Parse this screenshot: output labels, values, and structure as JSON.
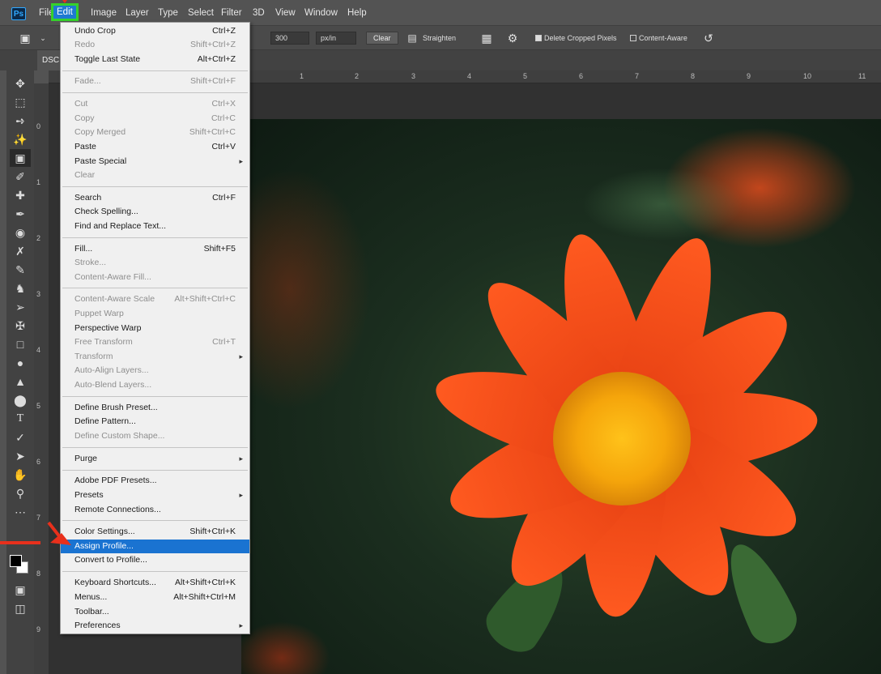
{
  "app": {
    "logo": "Ps"
  },
  "menubar": {
    "items": [
      "File",
      "Edit",
      "Image",
      "Layer",
      "Type",
      "Select",
      "Filter",
      "3D",
      "View",
      "Window",
      "Help"
    ]
  },
  "options": {
    "resolution_value": "300",
    "unit": "px/in",
    "clear_label": "Clear",
    "straighten_label": "Straighten",
    "delete_cropped_label": "Delete Cropped Pixels",
    "delete_cropped_checked": true,
    "content_aware_label": "Content-Aware",
    "content_aware_checked": false
  },
  "document": {
    "tab_label": "DSC"
  },
  "ruler": {
    "top_ticks": [
      "1",
      "2",
      "3",
      "4",
      "5",
      "6",
      "7",
      "8",
      "9",
      "10",
      "11"
    ],
    "left_ticks": [
      "0",
      "1",
      "2",
      "3",
      "4",
      "5",
      "6",
      "7",
      "8",
      "9"
    ]
  },
  "tools": [
    "move-icon",
    "marquee-icon",
    "lasso-icon",
    "quick-select-icon",
    "crop-icon",
    "eyedropper-icon",
    "healing-icon",
    "brush-icon",
    "stamp-icon",
    "history-brush-icon",
    "eraser-icon",
    "gradient-icon",
    "blur-icon",
    "dodge-icon",
    "pen-icon",
    "type-icon",
    "path-select-icon",
    "shape-icon",
    "hand-icon",
    "zoom-icon",
    "more-icon"
  ],
  "edit_menu": {
    "undo": "Undo Crop",
    "undo_sc": "Ctrl+Z",
    "redo": "Redo",
    "redo_sc": "Shift+Ctrl+Z",
    "toggle": "Toggle Last State",
    "toggle_sc": "Alt+Ctrl+Z",
    "fade": "Fade...",
    "fade_sc": "Shift+Ctrl+F",
    "cut": "Cut",
    "cut_sc": "Ctrl+X",
    "copy": "Copy",
    "copy_sc": "Ctrl+C",
    "copy_merged": "Copy Merged",
    "copy_merged_sc": "Shift+Ctrl+C",
    "paste": "Paste",
    "paste_sc": "Ctrl+V",
    "paste_special": "Paste Special",
    "clear": "Clear",
    "search": "Search",
    "search_sc": "Ctrl+F",
    "check_spelling": "Check Spelling...",
    "find_replace": "Find and Replace Text...",
    "fill": "Fill...",
    "fill_sc": "Shift+F5",
    "stroke": "Stroke...",
    "content_aware_fill": "Content-Aware Fill...",
    "content_aware_scale": "Content-Aware Scale",
    "content_aware_scale_sc": "Alt+Shift+Ctrl+C",
    "puppet_warp": "Puppet Warp",
    "perspective_warp": "Perspective Warp",
    "free_transform": "Free Transform",
    "free_transform_sc": "Ctrl+T",
    "transform": "Transform",
    "auto_align": "Auto-Align Layers...",
    "auto_blend": "Auto-Blend Layers...",
    "define_brush": "Define Brush Preset...",
    "define_pattern": "Define Pattern...",
    "define_shape": "Define Custom Shape...",
    "purge": "Purge",
    "pdf_presets": "Adobe PDF Presets...",
    "presets": "Presets",
    "remote": "Remote Connections...",
    "color_settings": "Color Settings...",
    "color_settings_sc": "Shift+Ctrl+K",
    "assign_profile": "Assign Profile...",
    "convert_profile": "Convert to Profile...",
    "keyboard_shortcuts": "Keyboard Shortcuts...",
    "keyboard_shortcuts_sc": "Alt+Shift+Ctrl+K",
    "menus": "Menus...",
    "menus_sc": "Alt+Shift+Ctrl+M",
    "toolbar": "Toolbar...",
    "preferences": "Preferences"
  },
  "colors": {
    "highlight": "#1a73d1",
    "edit_outline": "#35d12b",
    "arrow": "#e8301c"
  }
}
